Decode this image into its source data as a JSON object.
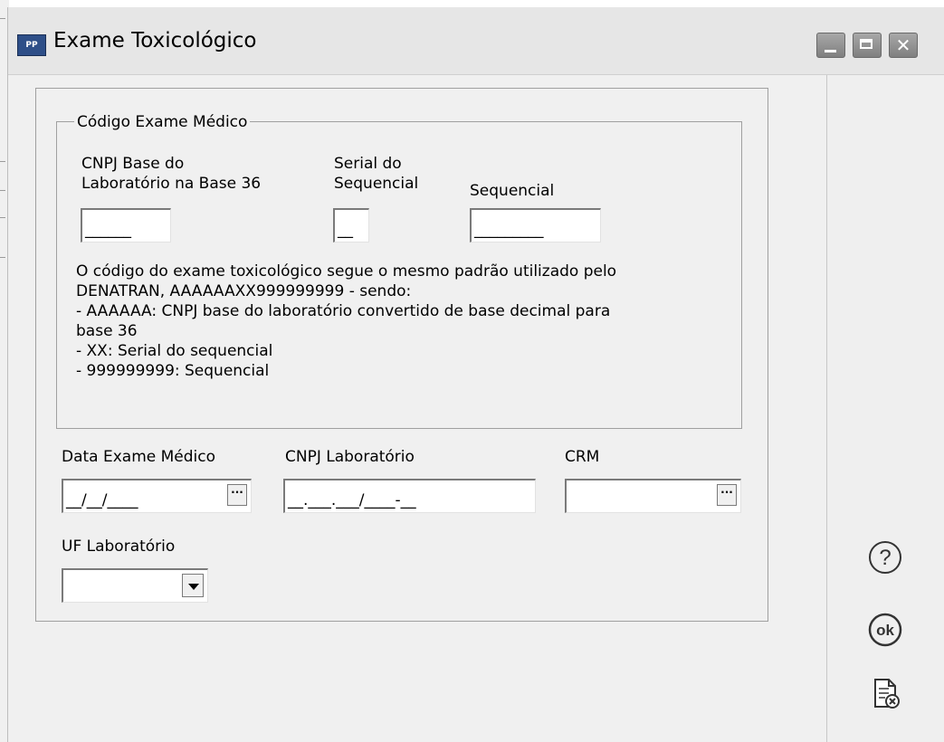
{
  "window": {
    "title": "Exame Toxicológico",
    "app_icon_label": "PP"
  },
  "group": {
    "legend": "Código Exame Médico",
    "cnpj_base_label_line1": "CNPJ Base do",
    "cnpj_base_label_line2": "Laboratório na Base 36",
    "cnpj_base_value": "______",
    "serial_label_line1": "Serial do",
    "serial_label_line2": "Sequencial",
    "serial_value": "__",
    "sequencial_label": "Sequencial",
    "sequencial_value": "_________",
    "info_lines": [
      "O código do exame toxicológico segue o mesmo padrão utilizado pelo",
      "DENATRAN, AAAAAAXX999999999 - sendo:",
      "- AAAAAA: CNPJ base do laboratório convertido de base decimal para",
      "base 36",
      "- XX: Serial do sequencial",
      "- 999999999: Sequencial"
    ]
  },
  "fields": {
    "data_exame_label": "Data Exame Médico",
    "data_exame_mask": "__/__/____",
    "cnpj_lab_label": "CNPJ Laboratório",
    "cnpj_lab_mask": "__.___.___/____-__",
    "crm_label": "CRM",
    "crm_value": "",
    "uf_label": "UF Laboratório",
    "uf_value": "",
    "ellipsis": "···"
  },
  "side_buttons": {
    "help_icon": "help-icon",
    "ok_icon": "ok-icon",
    "cancel_icon": "cancel-document-icon"
  }
}
